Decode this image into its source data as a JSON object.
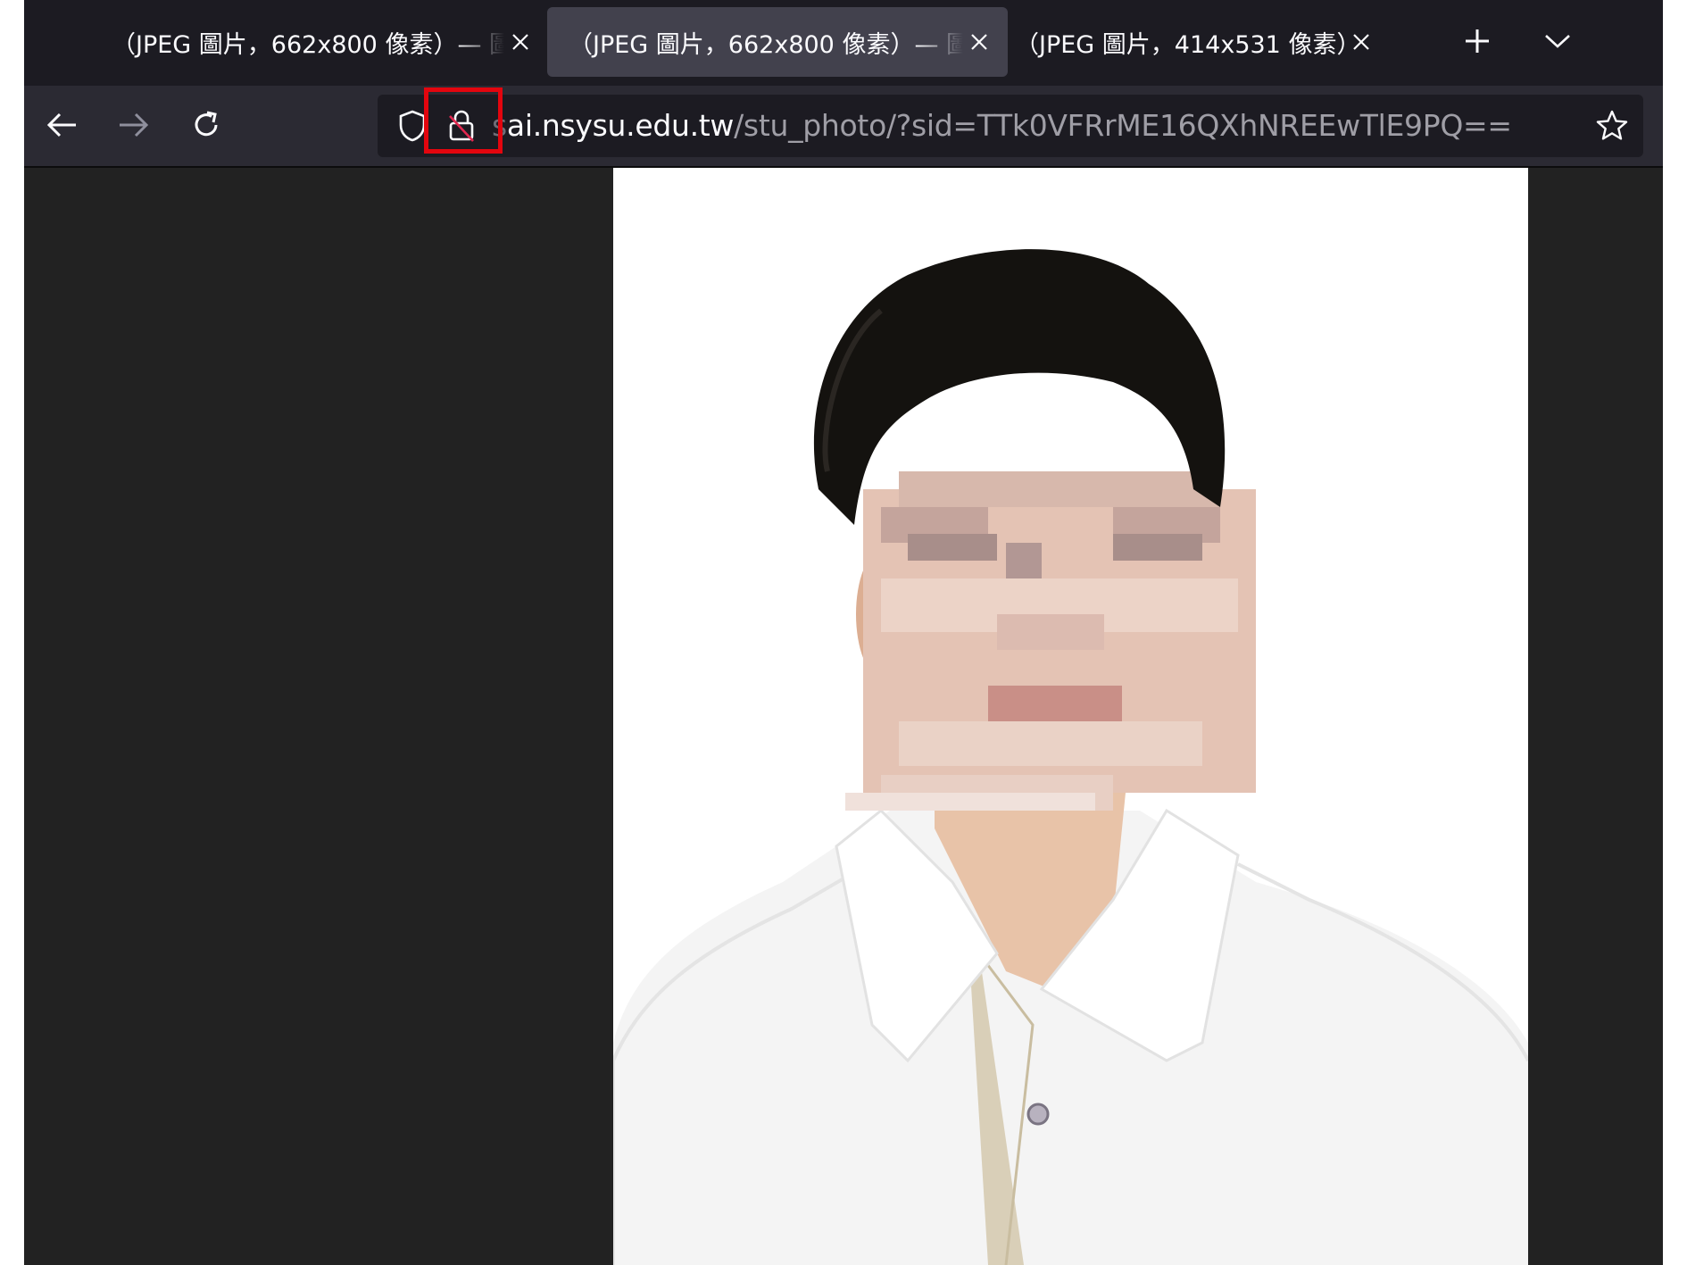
{
  "tabs": [
    {
      "label": "（JPEG 圖片，662x800 像素）— 圖",
      "active": false,
      "close_icon": "close-icon"
    },
    {
      "label": "（JPEG 圖片，662x800 像素）— 圖",
      "active": true,
      "close_icon": "close-icon"
    },
    {
      "label": "（JPEG 圖片，414x531 像素）",
      "active": false,
      "close_icon": "close-icon"
    }
  ],
  "tabstrip": {
    "new_tab_icon": "plus-icon",
    "list_tabs_icon": "chevron-down-icon"
  },
  "nav": {
    "back_icon": "back-arrow-icon",
    "forward_icon": "forward-arrow-icon",
    "reload_icon": "reload-icon"
  },
  "urlbar": {
    "tracking_icon": "shield-icon",
    "security_icon": "insecure-lock-icon",
    "url_prefix": "s",
    "url_host": "ai.nsysu.edu.tw",
    "url_path": "/stu_photo/?sid=TTk0VFRrME16QXhNREEwTlE9PQ==",
    "bookmark_icon": "star-icon"
  },
  "annotation": {
    "highlight_color": "#e3050e"
  },
  "content": {
    "image_description_icon": "student-id-photo",
    "background": "#222222"
  }
}
